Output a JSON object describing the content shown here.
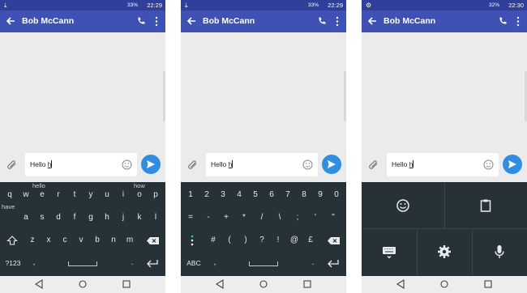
{
  "status_bar": [
    {
      "battery": "33%",
      "time": "22:29"
    },
    {
      "battery": "33%",
      "time": "22:29"
    },
    {
      "battery": "32%",
      "time": "22:30"
    }
  ],
  "conversation": {
    "contact_name": "Bob McCann"
  },
  "compose": {
    "typed_text": "Hello ",
    "composing_word": "h"
  },
  "phone1_keyboard": {
    "suggestions": [
      "hello",
      "have",
      "how"
    ],
    "row1": [
      "q",
      "w",
      "e",
      "r",
      "t",
      "y",
      "u",
      "i",
      "o",
      "p"
    ],
    "row2": [
      "a",
      "s",
      "d",
      "f",
      "g",
      "h",
      "j",
      "k",
      "l"
    ],
    "row3": [
      "z",
      "x",
      "c",
      "v",
      "b",
      "n",
      "m"
    ],
    "symbols_key": "?123",
    "comma_key": ",",
    "period_key": "."
  },
  "phone2_keyboard": {
    "row1": [
      "1",
      "2",
      "3",
      "4",
      "5",
      "6",
      "7",
      "8",
      "9",
      "0"
    ],
    "row2": [
      "=",
      "-",
      "+",
      "*",
      "/",
      "\\",
      ";",
      "'",
      "\""
    ],
    "row3": [
      "#",
      "(",
      ")",
      "?",
      "!",
      "@",
      "£"
    ],
    "abc_key": "ABC",
    "comma_key": ",",
    "period_key": "."
  },
  "phone3_panel": {
    "icons": [
      "emoji-icon",
      "clipboard-icon",
      "keyboard-icon",
      "settings-icon",
      "microphone-icon"
    ]
  },
  "colors": {
    "appbar": "#3f51b5",
    "statusbar": "#2f3f9a",
    "send": "#2f8ee0",
    "keyboard": "#263238"
  }
}
